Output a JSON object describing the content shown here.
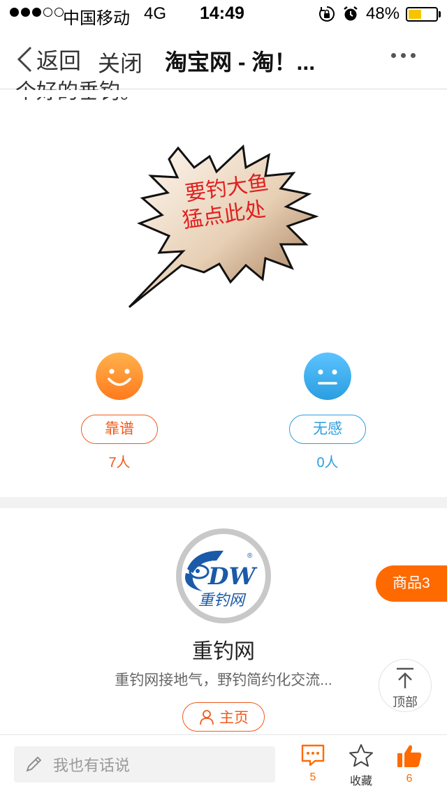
{
  "status_bar": {
    "signal_icon": "signal-dots-icon",
    "carrier": "中国移动",
    "network": "4G",
    "time": "14:49",
    "battery_percent": "48%",
    "battery_level": 0.48,
    "battery_color": "#f6c500"
  },
  "nav": {
    "back_label": "返回",
    "close_label": "关闭",
    "title": "淘宝网 - 淘！...",
    "more_icon": "more-dots-icon"
  },
  "article": {
    "cut_text": "个好的垂钓。",
    "banner_text_line1": "要钓大鱼",
    "banner_text_line2": "猛点此处"
  },
  "reactions": [
    {
      "label": "靠谱",
      "count": "7人",
      "color": "#f05a1a",
      "icon": "smile-face-icon"
    },
    {
      "label": "无感",
      "count": "0人",
      "color": "#2a9ee0",
      "icon": "neutral-face-icon"
    }
  ],
  "shop": {
    "logo_text": "重钓网",
    "name": "重钓网",
    "description": "重钓网接地气，野钓简约化交流...",
    "home_label": "主页"
  },
  "floating": {
    "goods_label": "商品3",
    "top_label": "顶部"
  },
  "toolbar": {
    "comment_placeholder": "我也有话说",
    "comments_count": "5",
    "favorite_label": "收藏",
    "likes_count": "6",
    "accent": "#ff6a00"
  }
}
